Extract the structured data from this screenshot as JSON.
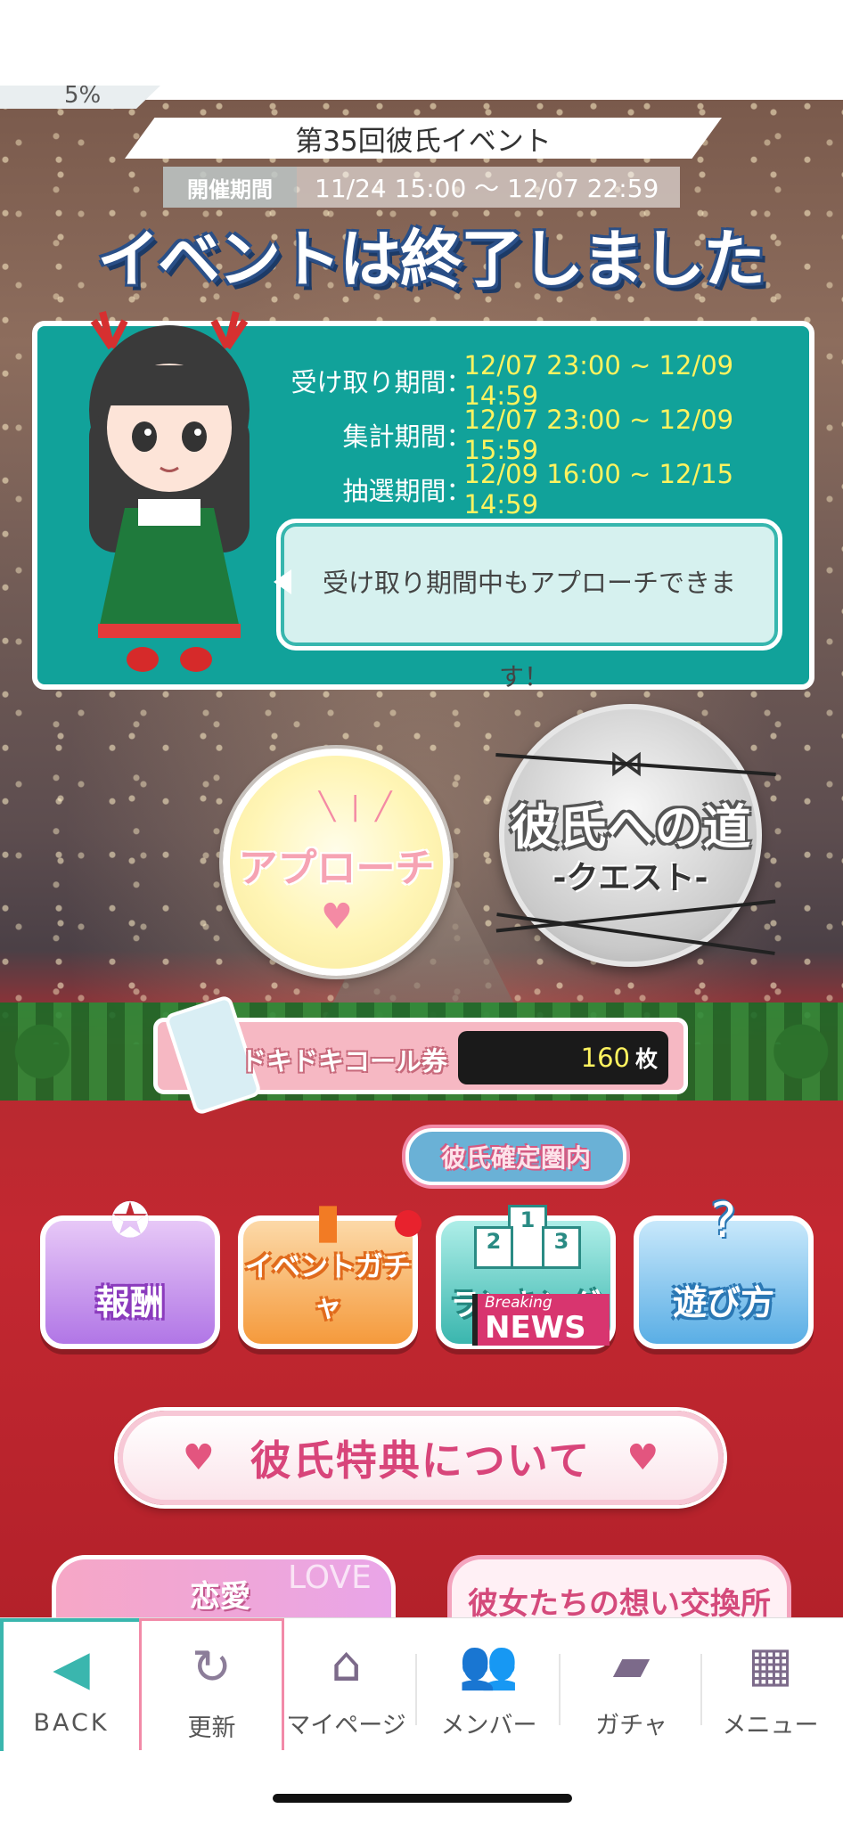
{
  "header": {
    "progress_text": "5%",
    "event_title": "第35回彼氏イベント",
    "period_label": "開催期間",
    "period_value": "11/24 15:00 〜 12/07 22:59",
    "ended_text": "イベントは終了しました"
  },
  "info_panel": {
    "rows": [
      {
        "label": "受け取り期間",
        "value": "12/07 23:00 ~ 12/09 14:59"
      },
      {
        "label": "集計期間",
        "value": "12/07 23:00 ~ 12/09 15:59"
      },
      {
        "label": "抽選期間",
        "value": "12/09 16:00 ~ 12/15 14:59"
      }
    ],
    "colon": "：",
    "speech_line1": "受け取り期間中もアプローチできま",
    "speech_line2": "す！"
  },
  "actions": {
    "approach_label": "アプローチ",
    "quest_title": "彼氏への道",
    "quest_subtitle": "-クエスト-"
  },
  "ticket": {
    "label": "ドキドキコール券",
    "count": "160",
    "unit": "枚"
  },
  "menu": {
    "rank_badge": "彼氏確定圏内",
    "reward_label": "報酬",
    "event_gacha_label": "イベントガチャ",
    "ranking_label": "ランキング",
    "news_breaking": "Breaking",
    "news_text": "NEWS",
    "howto_label": "遊び方",
    "podium": [
      "1",
      "2",
      "3"
    ]
  },
  "perks": {
    "label": "彼氏特典について"
  },
  "banners": {
    "love_label": "恋愛",
    "love_en": "LOVE",
    "exchange_label": "彼女たちの想い交換所"
  },
  "tabbar": {
    "back": "BACK",
    "refresh": "更新",
    "mypage": "マイページ",
    "member": "メンバー",
    "gacha": "ガチャ",
    "menu": "メニュー"
  },
  "colors": {
    "teal": "#11a29a",
    "highlight_yellow": "#fff35f",
    "pink": "#d8457a",
    "red_bg": "#c32831"
  }
}
